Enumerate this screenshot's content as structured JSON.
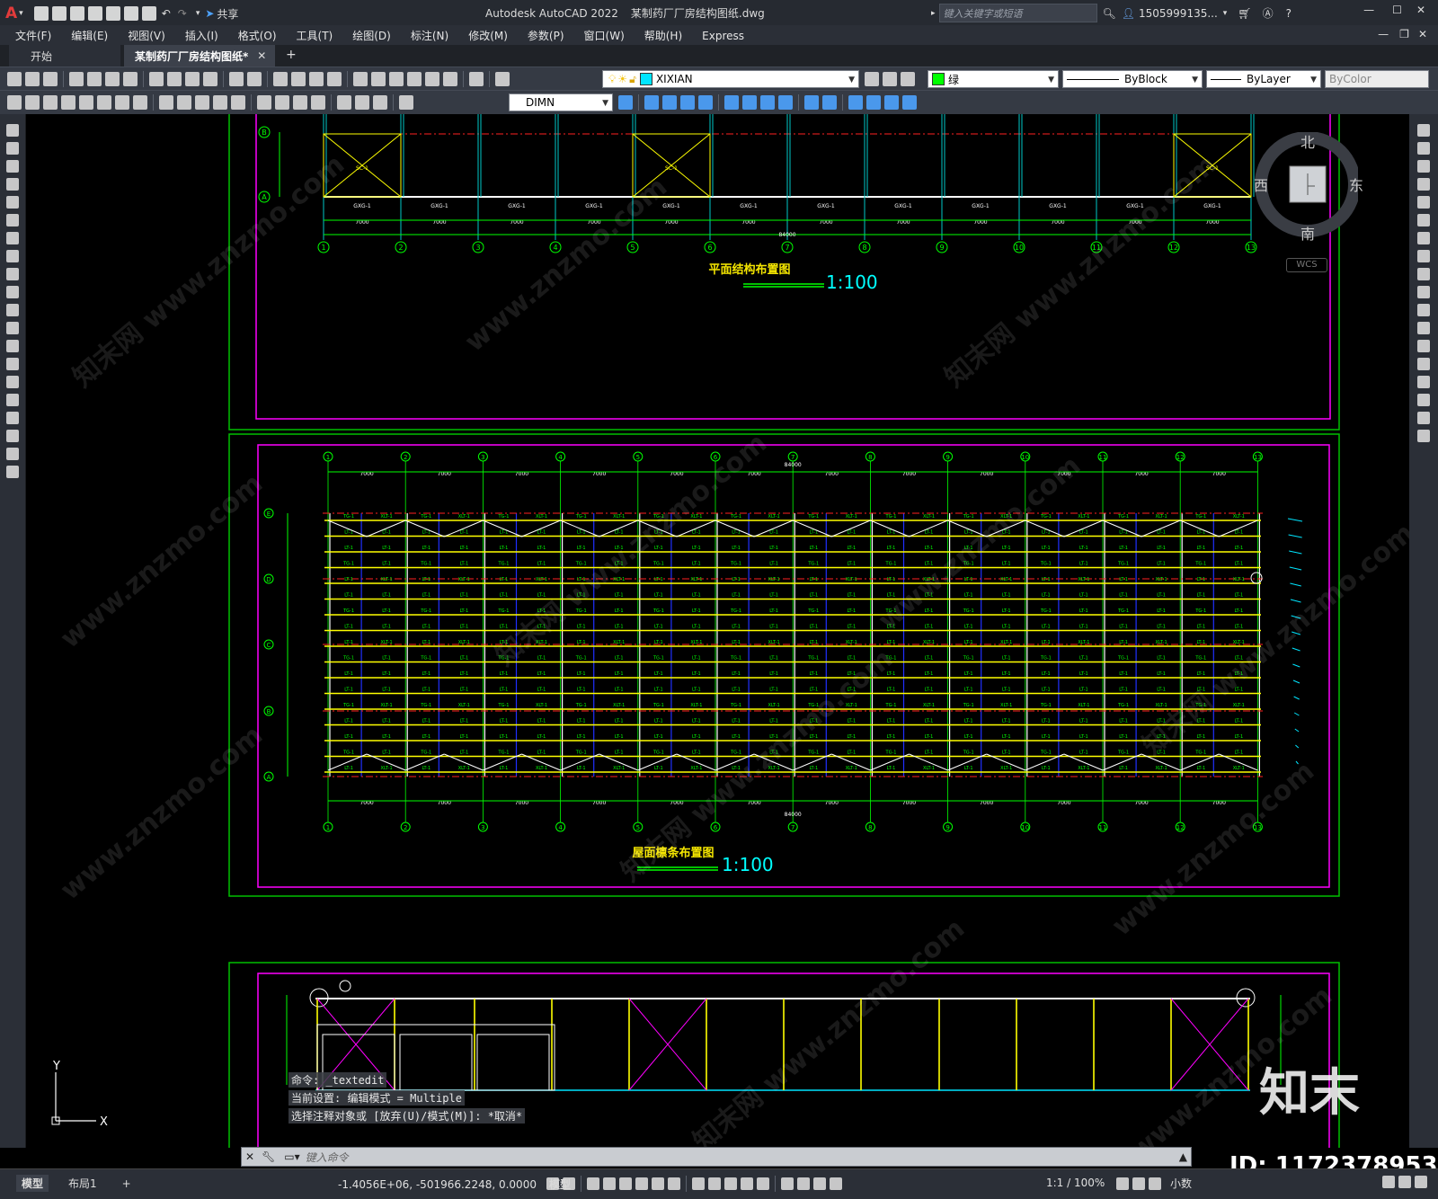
{
  "app": {
    "title": "Autodesk AutoCAD 2022",
    "document": "某制药厂厂房结构图纸.dwg",
    "search_placeholder": "键入关键字或短语",
    "user": "1505999135...",
    "share_label": "共享"
  },
  "menu": [
    "文件(F)",
    "编辑(E)",
    "视图(V)",
    "插入(I)",
    "格式(O)",
    "工具(T)",
    "绘图(D)",
    "标注(N)",
    "修改(M)",
    "参数(P)",
    "窗口(W)",
    "帮助(H)",
    "Express"
  ],
  "tabs": {
    "start": "开始",
    "active": "某制药厂厂房结构图纸*",
    "add": "+"
  },
  "toolbar": {
    "layer": "XIXIAN",
    "color": "绿",
    "linetype": "ByBlock",
    "lineweight": "ByLayer",
    "plotstyle": "ByColor",
    "dimstyle": "DIMN"
  },
  "viewcube": {
    "north": "北",
    "south": "南",
    "east": "东",
    "west": "西",
    "wcs": "WCS"
  },
  "drawing": {
    "plan_title": "平面结构布置图",
    "plan_scale": "1:100",
    "roof_title": "屋面檩条布置图",
    "roof_scale": "1:100",
    "plan_bays": [
      "7000",
      "7000",
      "7000",
      "7000",
      "7000",
      "7000",
      "7000",
      "7000",
      "7000",
      "7000",
      "7000",
      "7000"
    ],
    "total": "84000",
    "axis_numbers": [
      "1",
      "2",
      "3",
      "4",
      "5",
      "6",
      "7",
      "8",
      "9",
      "10",
      "11",
      "12",
      "13"
    ],
    "axis_letters": [
      "E",
      "D",
      "C",
      "B",
      "A"
    ],
    "brace_labels": [
      "SC-1",
      "SC-1",
      "SC-1"
    ],
    "beam_label": "GXG-1"
  },
  "command": {
    "history": [
      "命令: _textedit",
      "当前设置: 编辑模式 = Multiple",
      "选择注释对象或 [放弃(U)/模式(M)]: *取消*"
    ],
    "placeholder": "键入命令"
  },
  "ucs": {
    "y": "Y",
    "x": "X"
  },
  "layout_tabs": [
    "模型",
    "布局1",
    "+"
  ],
  "status": {
    "coords": "-1.4056E+06, -501966.2248, 0.0000",
    "mode": "模型",
    "scale": "1:1 / 100%",
    "units": "小数"
  },
  "watermark": {
    "brand": "知末",
    "id": "ID: 1172378953",
    "site": "www.znzmo.com",
    "cn": "知末网"
  }
}
